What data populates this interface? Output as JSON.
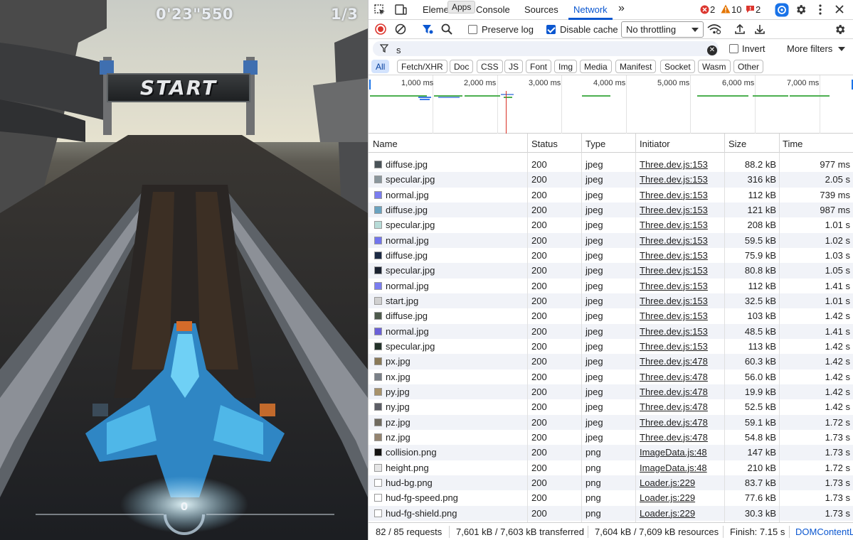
{
  "game": {
    "timer": "0'23\"550",
    "lap": "1/3",
    "sign": "START",
    "speed": "0"
  },
  "devtools": {
    "tabs": {
      "elements": "Eleme",
      "console": "Console",
      "sources": "Sources",
      "network": "Network",
      "more": "»"
    },
    "tooltip": "Apps",
    "badges": {
      "errors": "2",
      "warnings": "10",
      "issues": "2"
    },
    "toolbar": {
      "preserve_log": "Preserve log",
      "disable_cache": "Disable cache",
      "throttling": "No throttling"
    },
    "filter": {
      "value": "s",
      "invert": "Invert",
      "more_filters": "More filters"
    },
    "types": [
      "All",
      "Fetch/XHR",
      "Doc",
      "CSS",
      "JS",
      "Font",
      "Img",
      "Media",
      "Manifest",
      "Socket",
      "Wasm",
      "Other"
    ],
    "timeline_ticks": [
      "1,000 ms",
      "2,000 ms",
      "3,000 ms",
      "4,000 ms",
      "5,000 ms",
      "6,000 ms",
      "7,000 ms"
    ],
    "columns": {
      "name": "Name",
      "status": "Status",
      "type": "Type",
      "initiator": "Initiator",
      "size": "Size",
      "time": "Time"
    },
    "requests": [
      {
        "name": "diffuse.jpg",
        "status": "200",
        "type": "jpeg",
        "initiator": "Three.dev.js:153",
        "size": "88.2 kB",
        "time": "977 ms",
        "icon": "#4a5358"
      },
      {
        "name": "specular.jpg",
        "status": "200",
        "type": "jpeg",
        "initiator": "Three.dev.js:153",
        "size": "316 kB",
        "time": "2.05 s",
        "icon": "#8a969c"
      },
      {
        "name": "normal.jpg",
        "status": "200",
        "type": "jpeg",
        "initiator": "Three.dev.js:153",
        "size": "112 kB",
        "time": "739 ms",
        "icon": "#7b7ef0"
      },
      {
        "name": "diffuse.jpg",
        "status": "200",
        "type": "jpeg",
        "initiator": "Three.dev.js:153",
        "size": "121 kB",
        "time": "987 ms",
        "icon": "#6aa3c0"
      },
      {
        "name": "specular.jpg",
        "status": "200",
        "type": "jpeg",
        "initiator": "Three.dev.js:153",
        "size": "208 kB",
        "time": "1.01 s",
        "icon": "#b8dcd8"
      },
      {
        "name": "normal.jpg",
        "status": "200",
        "type": "jpeg",
        "initiator": "Three.dev.js:153",
        "size": "59.5 kB",
        "time": "1.02 s",
        "icon": "#7275ee"
      },
      {
        "name": "diffuse.jpg",
        "status": "200",
        "type": "jpeg",
        "initiator": "Three.dev.js:153",
        "size": "75.9 kB",
        "time": "1.03 s",
        "icon": "#1c2a44"
      },
      {
        "name": "specular.jpg",
        "status": "200",
        "type": "jpeg",
        "initiator": "Three.dev.js:153",
        "size": "80.8 kB",
        "time": "1.05 s",
        "icon": "#1a2230"
      },
      {
        "name": "normal.jpg",
        "status": "200",
        "type": "jpeg",
        "initiator": "Three.dev.js:153",
        "size": "112 kB",
        "time": "1.41 s",
        "icon": "#7b7ef0"
      },
      {
        "name": "start.jpg",
        "status": "200",
        "type": "jpeg",
        "initiator": "Three.dev.js:153",
        "size": "32.5 kB",
        "time": "1.01 s",
        "icon": "#d0d0d0"
      },
      {
        "name": "diffuse.jpg",
        "status": "200",
        "type": "jpeg",
        "initiator": "Three.dev.js:153",
        "size": "103 kB",
        "time": "1.42 s",
        "icon": "#4e5a4c"
      },
      {
        "name": "normal.jpg",
        "status": "200",
        "type": "jpeg",
        "initiator": "Three.dev.js:153",
        "size": "48.5 kB",
        "time": "1.41 s",
        "icon": "#6a60d8"
      },
      {
        "name": "specular.jpg",
        "status": "200",
        "type": "jpeg",
        "initiator": "Three.dev.js:153",
        "size": "113 kB",
        "time": "1.42 s",
        "icon": "#24332a"
      },
      {
        "name": "px.jpg",
        "status": "200",
        "type": "jpeg",
        "initiator": "Three.dev.js:478",
        "size": "60.3 kB",
        "time": "1.42 s",
        "icon": "#8a7a58"
      },
      {
        "name": "nx.jpg",
        "status": "200",
        "type": "jpeg",
        "initiator": "Three.dev.js:478",
        "size": "56.0 kB",
        "time": "1.42 s",
        "icon": "#7a8088"
      },
      {
        "name": "py.jpg",
        "status": "200",
        "type": "jpeg",
        "initiator": "Three.dev.js:478",
        "size": "19.9 kB",
        "time": "1.42 s",
        "icon": "#a8926a"
      },
      {
        "name": "ny.jpg",
        "status": "200",
        "type": "jpeg",
        "initiator": "Three.dev.js:478",
        "size": "52.5 kB",
        "time": "1.42 s",
        "icon": "#5c5e66"
      },
      {
        "name": "pz.jpg",
        "status": "200",
        "type": "jpeg",
        "initiator": "Three.dev.js:478",
        "size": "59.1 kB",
        "time": "1.72 s",
        "icon": "#6f6a5e"
      },
      {
        "name": "nz.jpg",
        "status": "200",
        "type": "jpeg",
        "initiator": "Three.dev.js:478",
        "size": "54.8 kB",
        "time": "1.73 s",
        "icon": "#948470"
      },
      {
        "name": "collision.png",
        "status": "200",
        "type": "png",
        "initiator": "ImageData.js:48",
        "size": "147 kB",
        "time": "1.73 s",
        "icon": "#111111"
      },
      {
        "name": "height.png",
        "status": "200",
        "type": "png",
        "initiator": "ImageData.js:48",
        "size": "210 kB",
        "time": "1.72 s",
        "icon": "#e6e6e6"
      },
      {
        "name": "hud-bg.png",
        "status": "200",
        "type": "png",
        "initiator": "Loader.js:229",
        "size": "83.7 kB",
        "time": "1.73 s",
        "icon": "#ffffff"
      },
      {
        "name": "hud-fg-speed.png",
        "status": "200",
        "type": "png",
        "initiator": "Loader.js:229",
        "size": "77.6 kB",
        "time": "1.73 s",
        "icon": "#ffffff"
      },
      {
        "name": "hud-fg-shield.png",
        "status": "200",
        "type": "png",
        "initiator": "Loader.js:229",
        "size": "30.3 kB",
        "time": "1.73 s",
        "icon": "#ffffff"
      }
    ],
    "status": {
      "requests": "82 / 85 requests",
      "transferred": "7,601 kB / 7,603 kB transferred",
      "resources": "7,604 kB / 7,609 kB resources",
      "finish": "Finish: 7.15 s",
      "domcontent": "DOMContentL"
    }
  }
}
